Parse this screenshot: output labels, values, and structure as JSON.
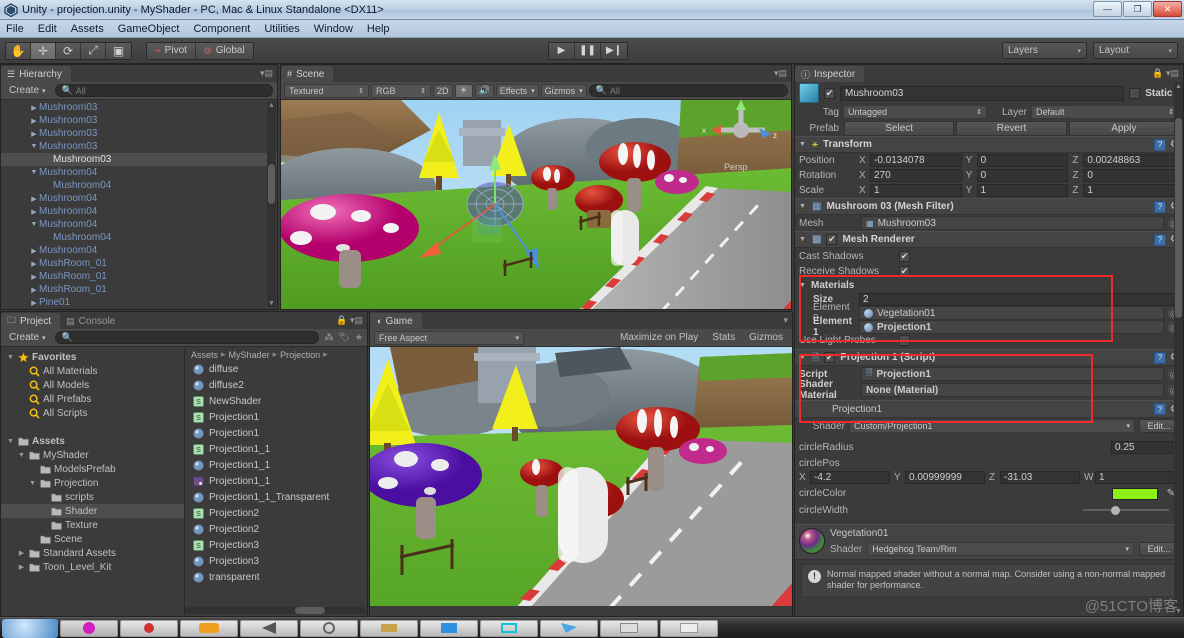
{
  "window": {
    "title": "Unity - projection.unity - MyShader - PC, Mac & Linux Standalone <DX11>",
    "minimize_label": "—",
    "restore_label": "❐",
    "close_label": "✕"
  },
  "menubar": {
    "items": [
      "File",
      "Edit",
      "Assets",
      "GameObject",
      "Component",
      "Utilities",
      "Window",
      "Help"
    ]
  },
  "toolbar": {
    "transform_tools": [
      "hand-tool",
      "move-tool",
      "rotate-tool",
      "scale-tool",
      "rect-tool"
    ],
    "pivot_label": "Pivot",
    "global_label": "Global",
    "play_label": "▶",
    "pause_label": "❚❚",
    "step_label": "▶❙",
    "layers_label": "Layers",
    "layout_label": "Layout",
    "dropdown_arrow": "▾"
  },
  "hierarchy": {
    "tab_label": "Hierarchy",
    "create_label": "Create",
    "create_arrow": "▾",
    "search_placeholder": "All",
    "items": [
      {
        "label": "Mushroom03",
        "indent": 2,
        "fold": "▶",
        "selected": false
      },
      {
        "label": "Mushroom03",
        "indent": 2,
        "fold": "▶",
        "selected": false
      },
      {
        "label": "Mushroom03",
        "indent": 2,
        "fold": "▶",
        "selected": false
      },
      {
        "label": "Mushroom03",
        "indent": 2,
        "fold": "▼",
        "selected": false
      },
      {
        "label": "Mushroom03",
        "indent": 3,
        "fold": "",
        "selected": true
      },
      {
        "label": "Mushroom04",
        "indent": 2,
        "fold": "▼",
        "selected": false
      },
      {
        "label": "Mushroom04",
        "indent": 3,
        "fold": "",
        "selected": false
      },
      {
        "label": "Mushroom04",
        "indent": 2,
        "fold": "▶",
        "selected": false
      },
      {
        "label": "Mushroom04",
        "indent": 2,
        "fold": "▶",
        "selected": false
      },
      {
        "label": "Mushroom04",
        "indent": 2,
        "fold": "▼",
        "selected": false
      },
      {
        "label": "Mushroom04",
        "indent": 3,
        "fold": "",
        "selected": false
      },
      {
        "label": "Mushroom04",
        "indent": 2,
        "fold": "▶",
        "selected": false
      },
      {
        "label": "MushRoom_01",
        "indent": 2,
        "fold": "▶",
        "selected": false
      },
      {
        "label": "MushRoom_01",
        "indent": 2,
        "fold": "▶",
        "selected": false
      },
      {
        "label": "MushRoom_01",
        "indent": 2,
        "fold": "▶",
        "selected": false
      },
      {
        "label": "Pine01",
        "indent": 2,
        "fold": "▶",
        "selected": false
      }
    ]
  },
  "scene": {
    "tab_label": "Scene",
    "draw_mode": "Textured",
    "render_mode": "RGB",
    "two_d_label": "2D",
    "lighting_icon": "sun-icon",
    "audio_icon": "speaker-icon",
    "effects_label": "Effects",
    "gizmos_label": "Gizmos",
    "search_placeholder": "All",
    "persp_label": "Persp",
    "axis_x": "x",
    "axis_y": "y",
    "axis_z": "z"
  },
  "project": {
    "tab_label": "Project",
    "console_tab_label": "Console",
    "create_label": "Create",
    "create_arrow": "▾",
    "search_placeholder": "",
    "breadcrumb": [
      "Assets",
      "MyShader",
      "Projection"
    ],
    "breadcrumb_sep": "▸",
    "tree": [
      {
        "label": "Favorites",
        "indent": 0,
        "fold": "▼",
        "icon": "star-icon",
        "bold": true,
        "selected": false
      },
      {
        "label": "All Materials",
        "indent": 1,
        "fold": "",
        "icon": "search-icon",
        "bold": false,
        "selected": false
      },
      {
        "label": "All Models",
        "indent": 1,
        "fold": "",
        "icon": "search-icon",
        "bold": false,
        "selected": false
      },
      {
        "label": "All Prefabs",
        "indent": 1,
        "fold": "",
        "icon": "search-icon",
        "bold": false,
        "selected": false
      },
      {
        "label": "All Scripts",
        "indent": 1,
        "fold": "",
        "icon": "search-icon",
        "bold": false,
        "selected": false
      },
      {
        "label": "",
        "indent": 0,
        "fold": "",
        "icon": "",
        "bold": false,
        "selected": false
      },
      {
        "label": "Assets",
        "indent": 0,
        "fold": "▼",
        "icon": "folder-icon",
        "bold": true,
        "selected": false
      },
      {
        "label": "MyShader",
        "indent": 1,
        "fold": "▼",
        "icon": "folder-icon",
        "bold": false,
        "selected": false
      },
      {
        "label": "ModelsPrefab",
        "indent": 2,
        "fold": "",
        "icon": "folder-icon",
        "bold": false,
        "selected": false
      },
      {
        "label": "Projection",
        "indent": 2,
        "fold": "▼",
        "icon": "folder-icon",
        "bold": false,
        "selected": false
      },
      {
        "label": "scripts",
        "indent": 3,
        "fold": "",
        "icon": "folder-icon",
        "bold": false,
        "selected": false
      },
      {
        "label": "Shader",
        "indent": 3,
        "fold": "",
        "icon": "folder-icon",
        "bold": false,
        "selected": true
      },
      {
        "label": "Texture",
        "indent": 3,
        "fold": "",
        "icon": "folder-icon",
        "bold": false,
        "selected": false
      },
      {
        "label": "Scene",
        "indent": 2,
        "fold": "",
        "icon": "folder-icon",
        "bold": false,
        "selected": false
      },
      {
        "label": "Standard Assets",
        "indent": 1,
        "fold": "▶",
        "icon": "folder-icon",
        "bold": false,
        "selected": false
      },
      {
        "label": "Toon_Level_Kit",
        "indent": 1,
        "fold": "▶",
        "icon": "folder-icon",
        "bold": false,
        "selected": false
      }
    ],
    "assets": [
      {
        "label": "diffuse",
        "type": "material"
      },
      {
        "label": "diffuse2",
        "type": "material"
      },
      {
        "label": "NewShader",
        "type": "shader"
      },
      {
        "label": "Projection1",
        "type": "shader"
      },
      {
        "label": "Projection1",
        "type": "material"
      },
      {
        "label": "Projection1_1",
        "type": "shader"
      },
      {
        "label": "Projection1_1",
        "type": "material"
      },
      {
        "label": "Projection1_1",
        "type": "texture"
      },
      {
        "label": "Projection1_1_Transparent",
        "type": "material"
      },
      {
        "label": "Projection2",
        "type": "shader"
      },
      {
        "label": "Projection2",
        "type": "material"
      },
      {
        "label": "Projection3",
        "type": "shader"
      },
      {
        "label": "Projection3",
        "type": "material"
      },
      {
        "label": "transparent",
        "type": "material"
      }
    ]
  },
  "game": {
    "tab_label": "Game",
    "aspect_label": "Free Aspect",
    "maximize_label": "Maximize on Play",
    "stats_label": "Stats",
    "gizmos_label": "Gizmos"
  },
  "inspector": {
    "tab_label": "Inspector",
    "object_name": "Mushroom03",
    "static_label": "Static",
    "tag_label": "Tag",
    "tag_value": "Untagged",
    "layer_label": "Layer",
    "layer_value": "Default",
    "prefab_label": "Prefab",
    "prefab_select": "Select",
    "prefab_revert": "Revert",
    "prefab_apply": "Apply",
    "transform": {
      "title": "Transform",
      "position_label": "Position",
      "position": {
        "x": "-0.0134078",
        "y": "0",
        "z": "0.00248863"
      },
      "rotation_label": "Rotation",
      "rotation": {
        "x": "270",
        "y": "0",
        "z": "0"
      },
      "scale_label": "Scale",
      "scale": {
        "x": "1",
        "y": "1",
        "z": "1"
      }
    },
    "mesh_filter": {
      "title": "Mushroom 03 (Mesh Filter)",
      "mesh_label": "Mesh",
      "mesh_value": "Mushroom03"
    },
    "mesh_renderer": {
      "title": "Mesh Renderer",
      "cast_shadows_label": "Cast Shadows",
      "receive_shadows_label": "Receive Shadows",
      "materials_label": "Materials",
      "size_label": "Size",
      "size_value": "2",
      "element0_label": "Element 0",
      "element0_value": "Vegetation01",
      "element1_label": "Element 1",
      "element1_value": "Projection1",
      "use_light_probes_label": "Use Light Probes"
    },
    "script_component": {
      "title": "Projection 1 (Script)",
      "script_label": "Script",
      "script_value": "Projection1",
      "shader_material_label": "Shader Material",
      "shader_material_value": "None (Material)"
    },
    "material_projection": {
      "title": "Projection1",
      "shader_label": "Shader",
      "shader_value": "Custom/Projection1",
      "edit_label": "Edit...",
      "circle_radius_label": "circleRadius",
      "circle_radius_value": "0.25",
      "circle_pos_label": "circlePos",
      "circle_pos": {
        "x": "-4.2",
        "y": "0.00999999",
        "z": "-31.03",
        "w": "1"
      },
      "circle_color_label": "circleColor",
      "circle_color_value": "#8EF019",
      "circle_width_label": "circleWidth"
    },
    "material_vegetation": {
      "title": "Vegetation01",
      "shader_label": "Shader",
      "shader_value": "Hedgehog Team/Rim",
      "edit_label": "Edit...",
      "warning": "Normal mapped shader without a normal map. Consider using a non-normal mapped shader for performance."
    }
  },
  "watermark": "@51CTO博客",
  "colors": {
    "panel_bg": "#3b3b3b",
    "header_bg": "#4a4a4a",
    "accent_red": "#ee2b2b",
    "text": "#b4b4b4",
    "hierarchy_text": "#7b96c4"
  }
}
